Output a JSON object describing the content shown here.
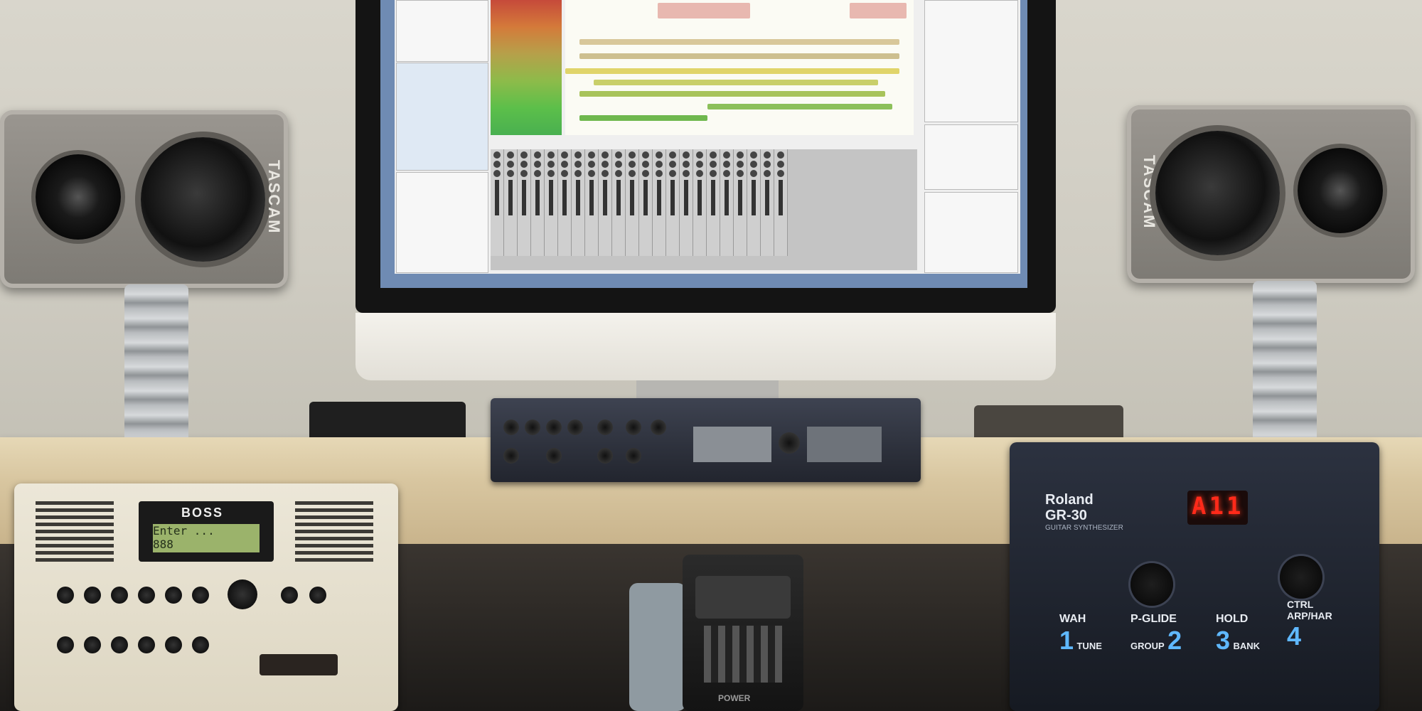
{
  "speakers": {
    "brand": "TASCAM"
  },
  "boss": {
    "logo": "BOSS",
    "lcd_line1": "Enter  ...",
    "lcd_line2": "  888"
  },
  "roland": {
    "brand": "Roland",
    "model": "GR-30",
    "subtitle": "GUITAR SYNTHESIZER",
    "display": "A11",
    "pedal_labels": [
      {
        "top": "WAH",
        "bottom": "TUNE",
        "number": "1"
      },
      {
        "top": "P-GLIDE",
        "bottom": "GROUP",
        "number": "2"
      },
      {
        "top": "HOLD",
        "bottom": "BANK",
        "number": "3"
      },
      {
        "top": "CTRL ARP/HAR",
        "bottom": "",
        "number": "4"
      }
    ]
  },
  "pedal": {
    "brand": "POWER"
  },
  "colors": {
    "screen_bg": "#6f8bb3",
    "led": "#ff2a1a",
    "roland_accent": "#5fb8ff"
  }
}
